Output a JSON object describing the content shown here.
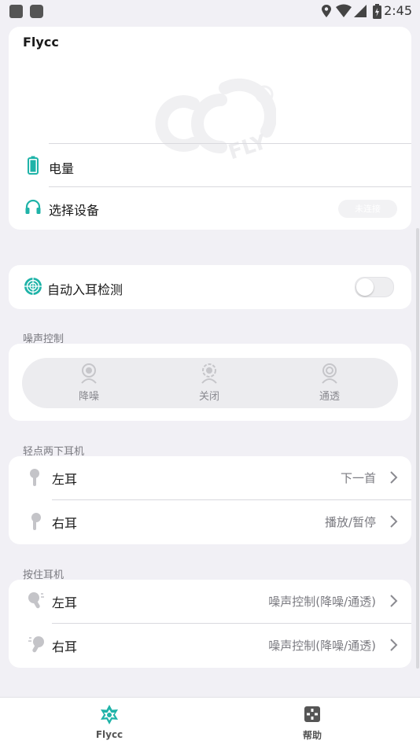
{
  "status_bar": {
    "time": "2:45"
  },
  "device_card": {
    "title": "Flycc",
    "battery_label": "电量",
    "select_device_label": "选择设备",
    "connect_button_label": "未连接"
  },
  "auto_ear": {
    "label": "自动入耳检测",
    "enabled": false
  },
  "noise_control": {
    "section_label": "噪声控制",
    "options": [
      {
        "label": "降噪",
        "icon": "noise-cancel-icon"
      },
      {
        "label": "关闭",
        "icon": "noise-off-icon"
      },
      {
        "label": "通透",
        "icon": "transparency-icon"
      }
    ]
  },
  "double_tap": {
    "section_label": "轻点两下耳机",
    "rows": [
      {
        "side": "左耳",
        "value": "下一首"
      },
      {
        "side": "右耳",
        "value": "播放/暂停"
      }
    ]
  },
  "long_press": {
    "section_label": "按住耳机",
    "rows": [
      {
        "side": "左耳",
        "value": "噪声控制(降噪/通透)"
      },
      {
        "side": "右耳",
        "value": "噪声控制(降噪/通透)"
      }
    ]
  },
  "tabs": [
    {
      "label": "Flycc",
      "icon": "flycc-star-icon",
      "active": true
    },
    {
      "label": "帮助",
      "icon": "help-icon",
      "active": false
    }
  ],
  "colors": {
    "accent": "#1fb3a8",
    "background": "#f1f0f5",
    "card": "#ffffff"
  }
}
